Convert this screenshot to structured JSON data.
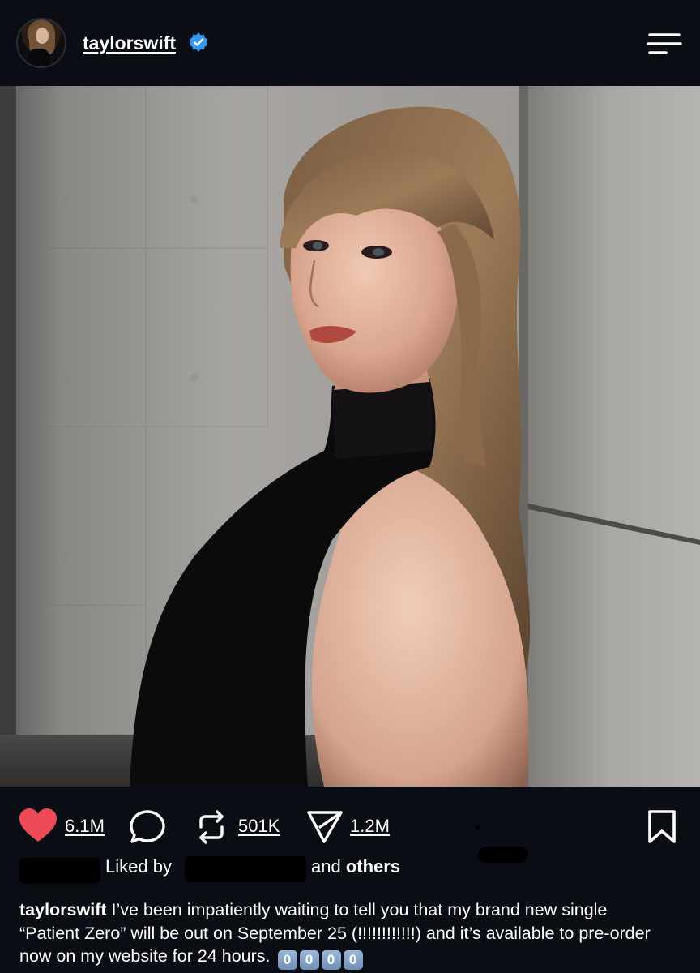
{
  "header": {
    "username": "taylorswift",
    "verified": true,
    "avatar_alt": "profile avatar"
  },
  "post": {
    "image_alt": "Portrait photo against a concrete wall"
  },
  "actions": {
    "likes": "6.1M",
    "reposts": "501K",
    "shares": "1.2M",
    "like_color": "#ed4956"
  },
  "liked_by": {
    "prefix": "Liked by",
    "and": "and",
    "others": "others"
  },
  "caption": {
    "username": "taylorswift",
    "text": " I’ve been impatiently waiting to tell you that my brand new single “Patient Zero” will be out on September 25 (!!!!!!!!!!!!) and it’s available to pre-order now on my website for 24 hours.",
    "keycaps": [
      "0",
      "0",
      "0",
      "0"
    ]
  },
  "colors": {
    "background": "#0b0d14",
    "verified_badge": "#3897f0",
    "text": "#ffffff"
  }
}
